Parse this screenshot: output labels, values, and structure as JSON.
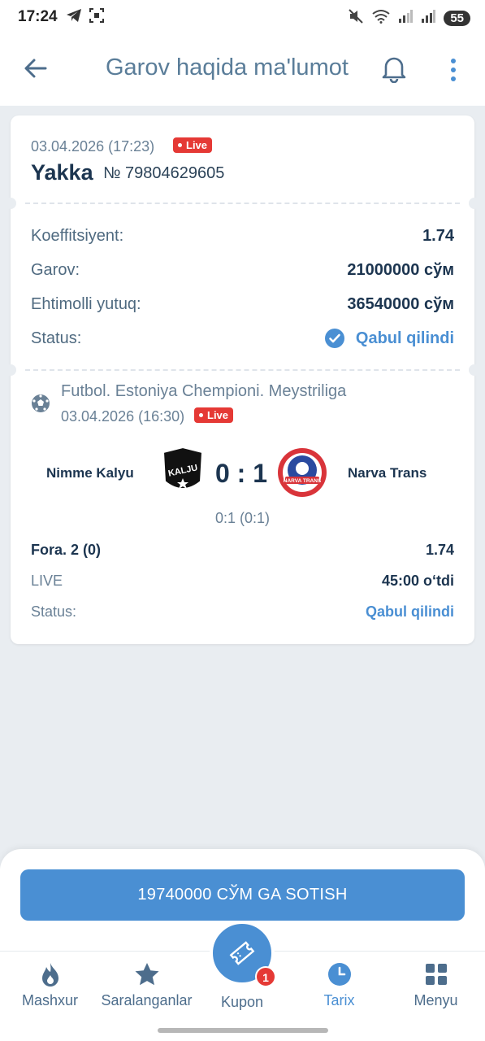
{
  "status_bar": {
    "time": "17:24",
    "battery": "55"
  },
  "header": {
    "title": "Garov haqida ma'lumot"
  },
  "bet": {
    "datetime": "03.04.2026 (17:23)",
    "live_label": "Live",
    "type": "Yakka",
    "number": "№ 79804629605",
    "rows": [
      {
        "label": "Koeffitsiyent:",
        "value": "1.74"
      },
      {
        "label": "Garov:",
        "value": "21000000 сўм"
      },
      {
        "label": "Ehtimolli yutuq:",
        "value": "36540000 сўм"
      }
    ],
    "status_label": "Status:",
    "status_value": "Qabul qilindi"
  },
  "event": {
    "league": "Futbol. Estoniya Chempioni. Meystriliga",
    "datetime": "03.04.2026 (16:30)",
    "live_label": "Live",
    "home_team": "Nimme Kalyu",
    "away_team": "Narva Trans",
    "home_logo_text": "KALJU",
    "away_logo_text": "NARVA TRANS",
    "score": "0 : 1",
    "subscore": "0:1 (0:1)",
    "market": "Fora. 2 (0)",
    "market_coef": "1.74",
    "state_label": "LIVE",
    "state_value": "45:00 o‘tdi",
    "status_label": "Status:",
    "status_value": "Qabul qilindi"
  },
  "sell_button": "19740000 СЎМ GA SOTISH",
  "bottom_nav": {
    "items": [
      {
        "label": "Mashxur",
        "icon": "flame-icon"
      },
      {
        "label": "Saralanganlar",
        "icon": "star-icon"
      },
      {
        "label": "Kupon",
        "icon": "ticket-icon"
      },
      {
        "label": "Tarix",
        "icon": "clock-icon"
      },
      {
        "label": "Menyu",
        "icon": "grid-icon"
      }
    ],
    "kupon_badge": "1"
  },
  "colors": {
    "accent": "#4a8fd3",
    "live": "#e53935",
    "background": "#e9edf1"
  }
}
